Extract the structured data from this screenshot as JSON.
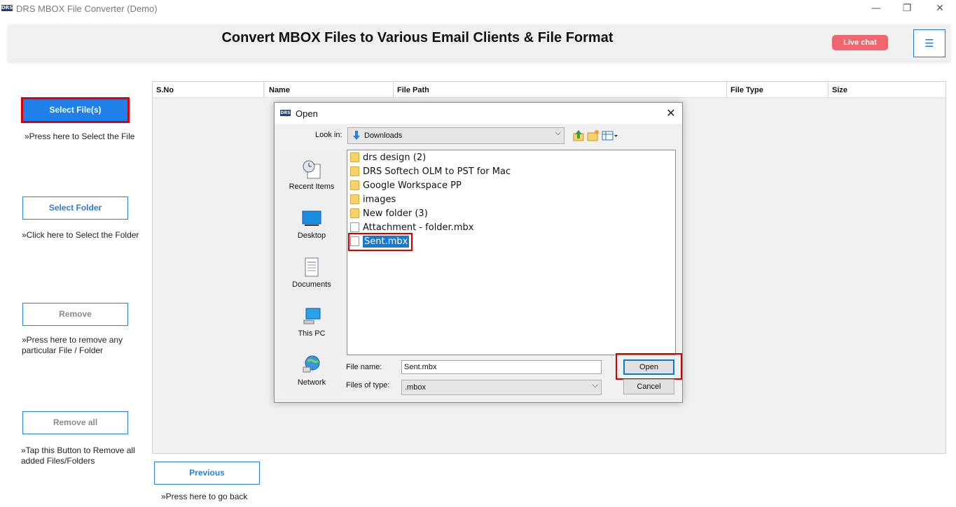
{
  "window": {
    "logo": "DRS",
    "title": "DRS MBOX File Converter (Demo)",
    "minimize": "—",
    "restore": "❐",
    "close": "✕"
  },
  "header": {
    "title": "Convert MBOX Files to Various Email Clients & File Format",
    "live_chat": "Live chat",
    "menu_icon": "☰"
  },
  "sidebar": {
    "buttons": [
      {
        "label": "Select File(s)",
        "hint": "»Press here to Select the File"
      },
      {
        "label": "Select Folder",
        "hint": "»Click here to Select the Folder"
      },
      {
        "label": "Remove",
        "hint": "»Press here to remove any particular File / Folder"
      },
      {
        "label": "Remove all",
        "hint": "»Tap this Button to Remove all added Files/Folders"
      }
    ]
  },
  "table": {
    "columns": [
      "S.No",
      "Name",
      "File Path",
      "File Type",
      "Size"
    ],
    "rows": []
  },
  "footer": {
    "previous_label": "Previous",
    "previous_hint": "»Press here to go back"
  },
  "dialog": {
    "logo": "DRS",
    "title": "Open",
    "close": "✕",
    "look_in_label": "Look in:",
    "look_in_value": "Downloads",
    "chevron": "⌵",
    "places": [
      "Recent Items",
      "Desktop",
      "Documents",
      "This PC",
      "Network"
    ],
    "files": [
      {
        "name": "drs design (2)",
        "type": "folder"
      },
      {
        "name": "DRS Softech OLM to PST for Mac",
        "type": "folder"
      },
      {
        "name": "Google Workspace PP",
        "type": "folder"
      },
      {
        "name": "images",
        "type": "folder"
      },
      {
        "name": "New folder (3)",
        "type": "folder"
      },
      {
        "name": "Attachment - folder.mbx",
        "type": "file"
      },
      {
        "name": "Sent.mbx",
        "type": "file",
        "selected": true
      }
    ],
    "file_name_label": "File name:",
    "file_name_value": "Sent.mbx",
    "file_type_label": "Files of type:",
    "file_type_value": ".mbox",
    "open_label": "Open",
    "cancel_label": "Cancel"
  },
  "colors": {
    "accent": "#1e80e8",
    "highlight_frame": "#d40000",
    "live_chat": "#f0656e",
    "selection": "#1679d8"
  }
}
